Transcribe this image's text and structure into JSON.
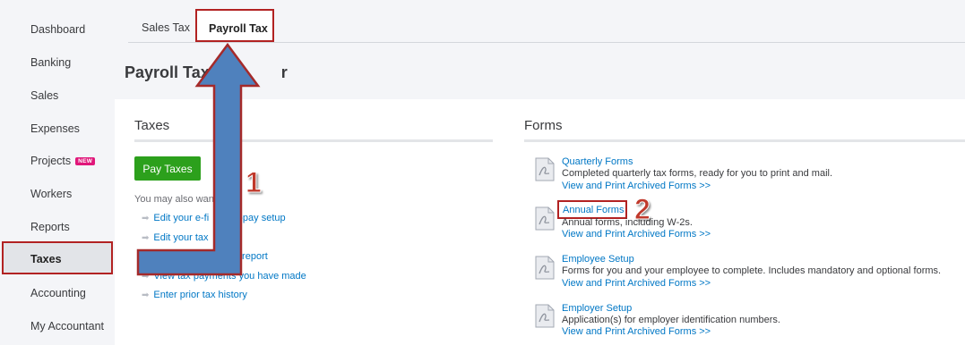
{
  "sidebar": {
    "items": [
      {
        "label": "Dashboard"
      },
      {
        "label": "Banking"
      },
      {
        "label": "Sales"
      },
      {
        "label": "Expenses"
      },
      {
        "label": "Projects",
        "badge": "NEW"
      },
      {
        "label": "Workers"
      },
      {
        "label": "Reports"
      },
      {
        "label": "Taxes"
      },
      {
        "label": "Accounting"
      },
      {
        "label": "My Accountant"
      }
    ]
  },
  "tabs": {
    "sales_tax": "Sales Tax",
    "payroll_tax": "Payroll Tax"
  },
  "page": {
    "title_visible": "Payroll Tax C",
    "title_tail": "r"
  },
  "taxes": {
    "title": "Taxes",
    "pay_button": "Pay Taxes",
    "also_text": "You may also wan",
    "links": [
      {
        "left": "Edit your e-fi",
        "right": "e-pay setup"
      },
      {
        "left": "Edit your tax",
        "right": ""
      },
      {
        "left": "",
        "right": "ity report"
      },
      {
        "left": "View tax payments you have made",
        "right": ""
      },
      {
        "left": "Enter prior tax history",
        "right": ""
      }
    ]
  },
  "forms": {
    "title": "Forms",
    "items": [
      {
        "title": "Quarterly Forms",
        "desc": "Completed quarterly tax forms, ready for you to print and mail.",
        "link": "View and Print Archived Forms >>"
      },
      {
        "title": "Annual Forms",
        "desc": "Annual forms, including W-2s.",
        "link": "View and Print Archived Forms >>"
      },
      {
        "title": "Employee Setup",
        "desc": "Forms for you and your employee to complete. Includes mandatory and optional forms.",
        "link": "View and Print Archived Forms >>"
      },
      {
        "title": "Employer Setup",
        "desc": "Application(s) for employer identification numbers.",
        "link": "View and Print Archived Forms >>"
      }
    ]
  },
  "annotations": {
    "step1": "1",
    "step2": "2"
  },
  "colors": {
    "accent_green": "#2ca01c",
    "link_blue": "#0077c5",
    "highlight_red": "#b22222",
    "arrow_blue": "#4f81bd"
  }
}
